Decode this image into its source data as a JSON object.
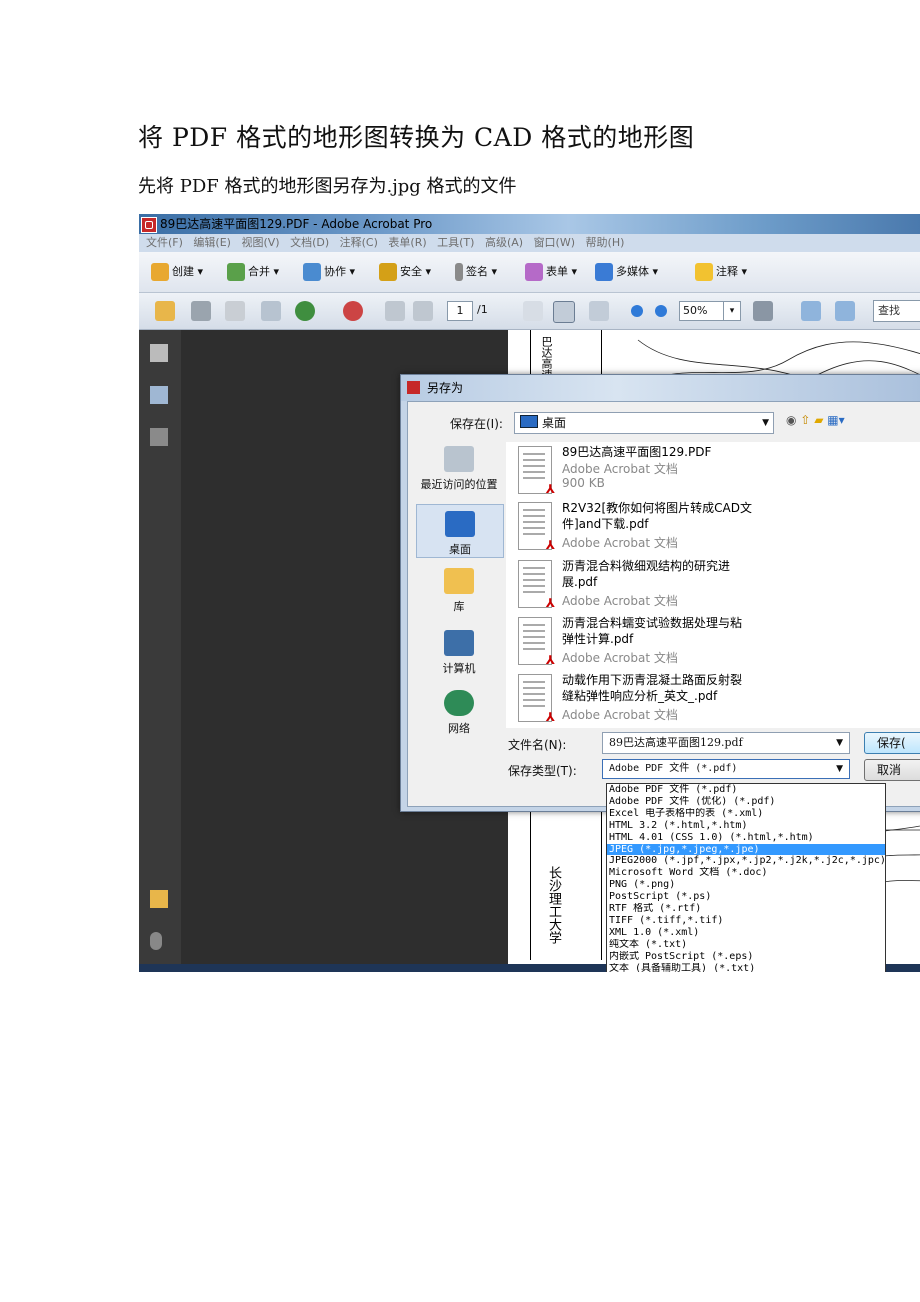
{
  "doc": {
    "title": "将 PDF 格式的地形图转换为 CAD 格式的地形图",
    "subtitle": "先将 PDF 格式的地形图另存为.jpg 格式的文件"
  },
  "app": {
    "window_title": "89巴达高速平面图129.PDF - Adobe Acrobat Pro",
    "menu": [
      "文件(F)",
      "编辑(E)",
      "视图(V)",
      "文档(D)",
      "注释(C)",
      "表单(R)",
      "工具(T)",
      "高级(A)",
      "窗口(W)",
      "帮助(H)"
    ],
    "toolbar1": [
      "创建",
      "合并",
      "协作",
      "安全",
      "签名",
      "表单",
      "多媒体",
      "注释"
    ],
    "page_num": "1",
    "page_total": "/1",
    "zoom": "50%",
    "find_label": "查找",
    "page_side_text": "长沙理工大学",
    "page_top_text": "巴达高速"
  },
  "dialog": {
    "title": "另存为",
    "save_in_label": "保存在(I):",
    "save_in_value": "桌面",
    "places": [
      "最近访问的位置",
      "桌面",
      "库",
      "计算机",
      "网络"
    ],
    "files": [
      {
        "name": "89巴达高速平面图129.PDF",
        "type": "Adobe Acrobat 文档",
        "size": "900 KB"
      },
      {
        "name": "R2V32[教你如何将图片转成CAD文件]and下载.pdf",
        "type": "Adobe Acrobat 文档"
      },
      {
        "name": "沥青混合料微细观结构的研究进展.pdf",
        "type": "Adobe Acrobat 文档"
      },
      {
        "name": "沥青混合料蠕变试验数据处理与粘弹性计算.pdf",
        "type": "Adobe Acrobat 文档"
      },
      {
        "name": "动载作用下沥青混凝土路面反射裂缝粘弹性响应分析_英文_.pdf",
        "type": "Adobe Acrobat 文档"
      }
    ],
    "filename_label": "文件名(N):",
    "filename_value": "89巴达高速平面图129.pdf",
    "filetype_label": "保存类型(T):",
    "filetype_value": "Adobe PDF 文件 (*.pdf)",
    "save_button": "保存(",
    "cancel_button": "取消",
    "filetype_options": [
      "Adobe PDF 文件 (*.pdf)",
      "Adobe PDF 文件 (优化) (*.pdf)",
      "Excel 电子表格中的表 (*.xml)",
      "HTML 3.2 (*.html,*.htm)",
      "HTML 4.01 (CSS 1.0) (*.html,*.htm)",
      "JPEG (*.jpg,*.jpeg,*.jpe)",
      "JPEG2000 (*.jpf,*.jpx,*.jp2,*.j2k,*.j2c,*.jpc)",
      "Microsoft Word 文档 (*.doc)",
      "PNG (*.png)",
      "PostScript (*.ps)",
      "RTF 格式 (*.rtf)",
      "TIFF (*.tiff,*.tif)",
      "XML 1.0 (*.xml)",
      "纯文本 (*.txt)",
      "内嵌式 PostScript (*.eps)",
      "文本 (具备辅助工具) (*.txt)"
    ],
    "highlighted_option": "JPEG (*.jpg,*.jpeg,*.jpe)"
  },
  "colors": {
    "titlebar": "#6b98c8",
    "highlight": "#3399ff",
    "pdf_red": "#c62828"
  }
}
